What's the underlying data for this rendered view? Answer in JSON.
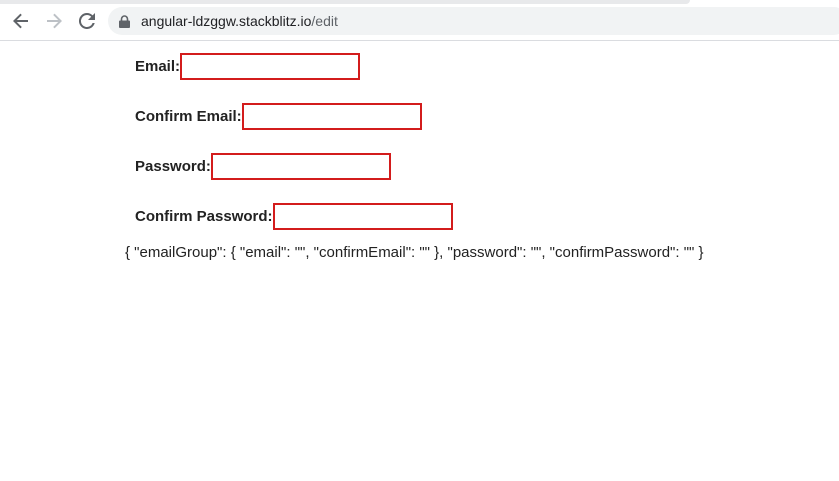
{
  "browser": {
    "url_host": "angular-ldzggw.stackblitz.io",
    "url_path": "/edit"
  },
  "form": {
    "email_label": "Email:",
    "email_value": "",
    "confirm_email_label": "Confirm Email:",
    "confirm_email_value": "",
    "password_label": "Password:",
    "password_value": "",
    "confirm_password_label": "Confirm Password:",
    "confirm_password_value": "",
    "invalid_border_color": "#d31c1c"
  },
  "output": {
    "json_text": "{ \"emailGroup\": { \"email\": \"\", \"confirmEmail\": \"\" }, \"password\": \"\", \"confirmPassword\": \"\" }"
  }
}
